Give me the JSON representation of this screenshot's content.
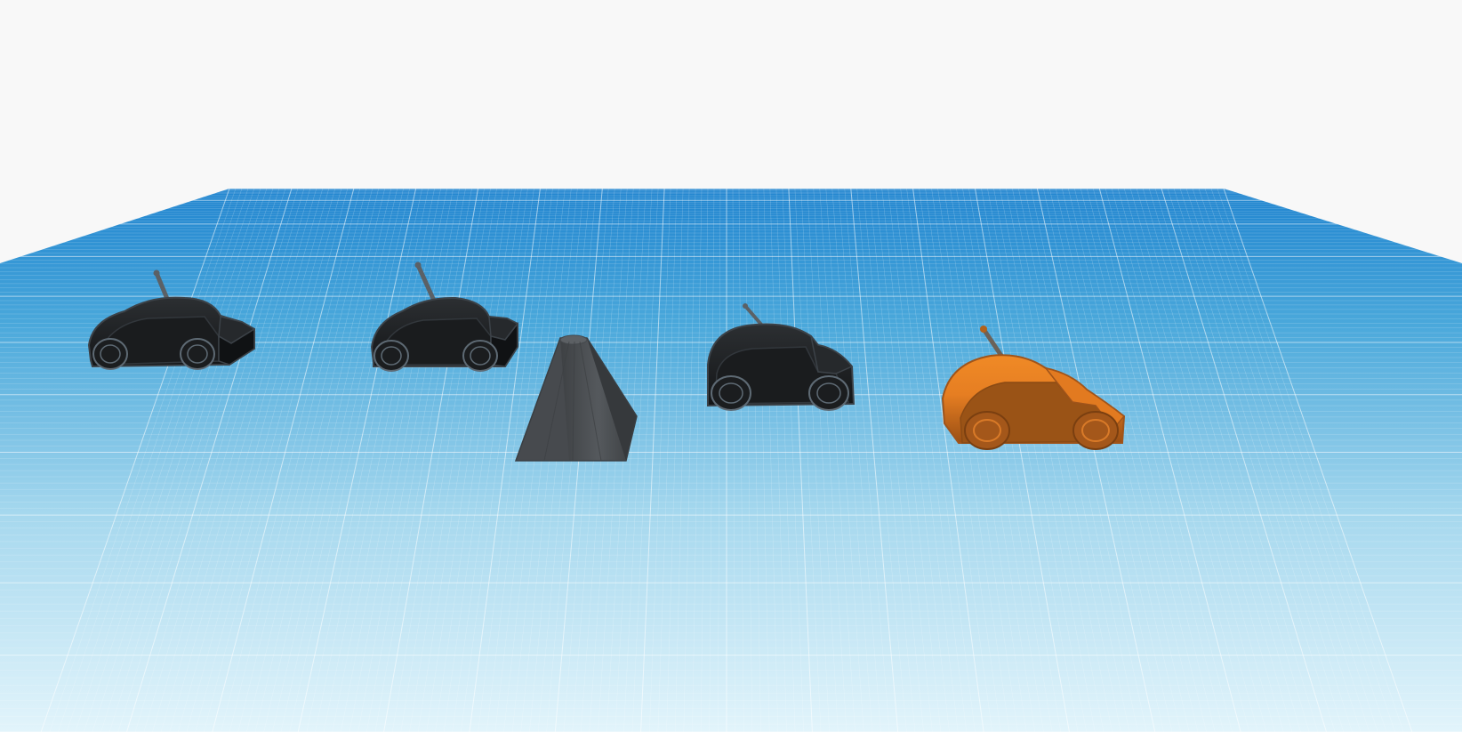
{
  "workspace": {
    "background_color": "#f8f8f8",
    "workplane_color_far": "#1e82cc",
    "workplane_color_near": "#dff2fa",
    "grid_line_color": "#ffffff"
  },
  "objects": [
    {
      "name": "car-1",
      "color": "#1e2022",
      "selected": false
    },
    {
      "name": "car-2",
      "color": "#1e2022",
      "selected": false
    },
    {
      "name": "cone",
      "color": "#4a4d50",
      "selected": false
    },
    {
      "name": "car-3",
      "color": "#1e2022",
      "selected": false
    },
    {
      "name": "car-4",
      "color": "#e67e22",
      "selected": false
    }
  ]
}
